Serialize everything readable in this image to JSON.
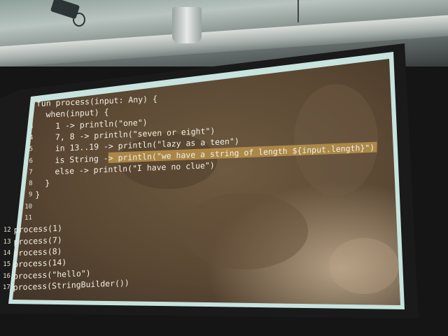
{
  "code_lines": [
    "fun process(input: Any) {",
    "  when(input) {",
    "    1 -> println(\"one\")",
    "    7, 8 -> println(\"seven or eight\")",
    "    in 13..19 -> println(\"lazy as a teen\")",
    "    is String -> println(\"we have a string of length ${input.length}\")",
    "    else -> println(\"I have no clue\")",
    "  }",
    "}",
    "",
    "",
    "process(1)",
    "process(7)",
    "process(8)",
    "process(14)",
    "process(\"hello\")",
    "process(StringBuilder())"
  ],
  "line_numbers": [
    "1",
    "2",
    "3",
    "4",
    "5",
    "6",
    "7",
    "8",
    "9",
    "10",
    "11",
    "12",
    "13",
    "14",
    "15",
    "16",
    "17"
  ],
  "colors": {
    "screen_frame": "#c7e3de",
    "screen_bg": "#5b4a36",
    "highlight": "#b8924a",
    "text": "#f2eee2"
  }
}
